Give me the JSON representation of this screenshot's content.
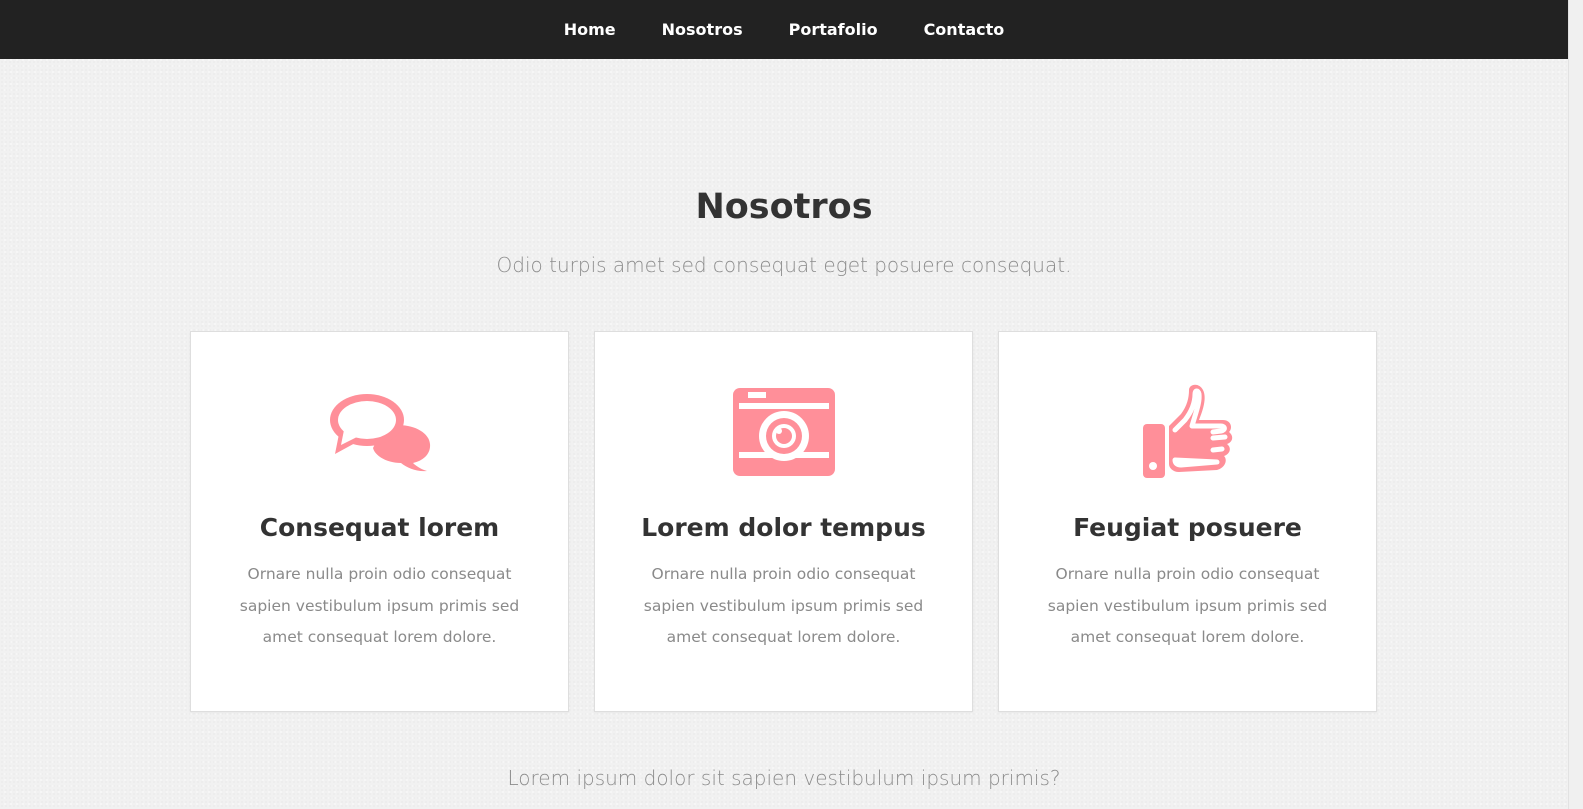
{
  "nav": {
    "items": [
      {
        "label": "Home"
      },
      {
        "label": "Nosotros"
      },
      {
        "label": "Portafolio"
      },
      {
        "label": "Contacto"
      }
    ]
  },
  "section": {
    "title": "Nosotros",
    "subtitle": "Odio turpis amet sed consequat eget posuere consequat."
  },
  "cards": [
    {
      "icon": "chat-bubbles-icon",
      "title": "Consequat lorem",
      "text": "Ornare nulla proin odio consequat sapien vestibulum ipsum primis sed amet consequat lorem dolore."
    },
    {
      "icon": "camera-icon",
      "title": "Lorem dolor tempus",
      "text": "Ornare nulla proin odio consequat sapien vestibulum ipsum primis sed amet consequat lorem dolore."
    },
    {
      "icon": "thumbs-up-icon",
      "title": "Feugiat posuere",
      "text": "Ornare nulla proin odio consequat sapien vestibulum ipsum primis sed amet consequat lorem dolore."
    }
  ],
  "bottom": {
    "text": "Lorem ipsum dolor sit sapien vestibulum ipsum primis?"
  },
  "colors": {
    "accent": "#ff8f99",
    "navbar": "#222222",
    "heading": "#333333",
    "muted": "#8c8c8c"
  }
}
